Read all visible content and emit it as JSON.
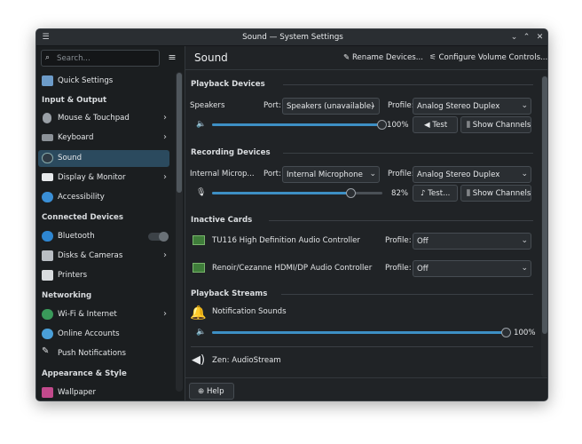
{
  "window": {
    "title": "Sound — System Settings"
  },
  "sidebar": {
    "search_placeholder": "Search...",
    "quick_settings": "Quick Settings",
    "sections": {
      "input_output": "Input & Output",
      "connected_devices": "Connected Devices",
      "networking": "Networking",
      "appearance": "Appearance & Style"
    },
    "items": {
      "mouse": "Mouse & Touchpad",
      "keyboard": "Keyboard",
      "sound": "Sound",
      "display": "Display & Monitor",
      "accessibility": "Accessibility",
      "bluetooth": "Bluetooth",
      "disks": "Disks & Cameras",
      "printers": "Printers",
      "wifi": "Wi-Fi & Internet",
      "online_accounts": "Online Accounts",
      "push": "Push Notifications",
      "wallpaper": "Wallpaper"
    }
  },
  "header": {
    "page_title": "Sound",
    "rename_devices": "Rename Devices...",
    "configure_volume": "Configure Volume Controls..."
  },
  "playback": {
    "title": "Playback Devices",
    "device_name": "Speakers",
    "port_label": "Port:",
    "port_value": "Speakers (unavailable)",
    "profile_label": "Profile:",
    "profile_value": "Analog Stereo Duplex",
    "volume_percent": 100,
    "volume_text": "100%",
    "test_label": "Test",
    "show_channels": "Show Channels"
  },
  "recording": {
    "title": "Recording Devices",
    "device_name": "Internal Microp...",
    "port_label": "Port:",
    "port_value": "Internal Microphone",
    "profile_label": "Profile:",
    "profile_value": "Analog Stereo Duplex",
    "volume_percent": 82,
    "volume_text": "82%",
    "test_label": "Test...",
    "show_channels": "Show Channels"
  },
  "inactive": {
    "title": "Inactive Cards",
    "cards": [
      {
        "name": "TU116 High Definition Audio Controller",
        "profile_label": "Profile:",
        "profile_value": "Off"
      },
      {
        "name": "Renoir/Cezanne HDMI/DP Audio Controller",
        "profile_label": "Profile:",
        "profile_value": "Off"
      }
    ]
  },
  "streams": {
    "title": "Playback Streams",
    "notification": {
      "name": "Notification Sounds",
      "volume_percent": 100,
      "volume_text": "100%"
    },
    "zen": {
      "name": "Zen: AudioStream"
    }
  },
  "footer": {
    "help": "Help"
  },
  "colors": {
    "accent": "#3d8fc4",
    "active_item": "#2b4a5e",
    "background": "#1e2124"
  }
}
